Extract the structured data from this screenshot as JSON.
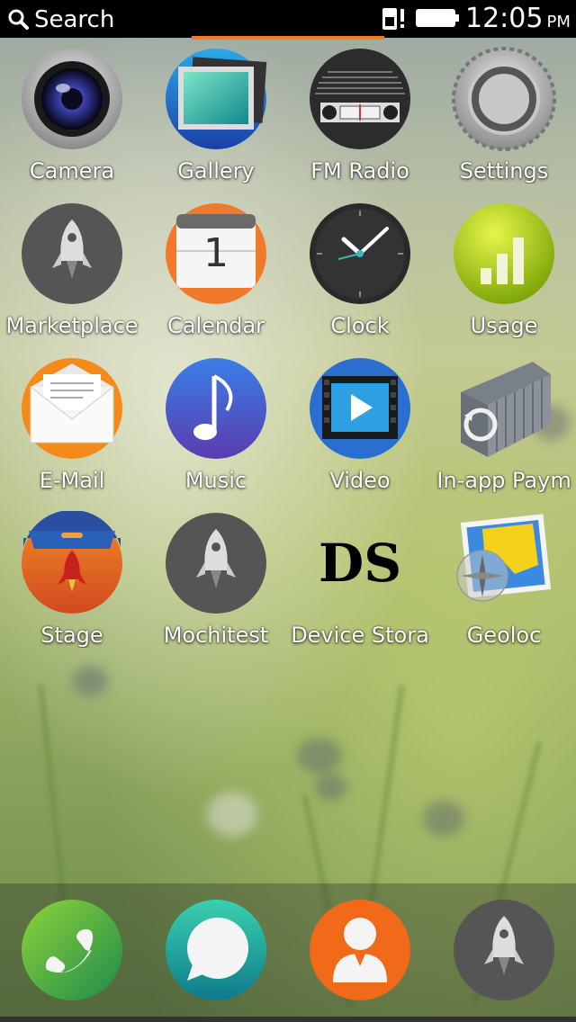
{
  "status_bar": {
    "search_label": "Search",
    "time": "12:05",
    "ampm": "PM"
  },
  "apps": [
    {
      "label": "Camera",
      "icon": "camera-icon"
    },
    {
      "label": "Gallery",
      "icon": "gallery-icon"
    },
    {
      "label": "FM Radio",
      "icon": "radio-icon"
    },
    {
      "label": "Settings",
      "icon": "settings-gear-icon"
    },
    {
      "label": "Marketplace",
      "icon": "rocket-icon"
    },
    {
      "label": "Calendar",
      "icon": "calendar-icon",
      "badge": "1"
    },
    {
      "label": "Clock",
      "icon": "clock-icon"
    },
    {
      "label": "Usage",
      "icon": "usage-bars-icon"
    },
    {
      "label": "E-Mail",
      "icon": "envelope-icon"
    },
    {
      "label": "Music",
      "icon": "music-note-icon"
    },
    {
      "label": "Video",
      "icon": "video-play-icon"
    },
    {
      "label": "In-app Paym",
      "icon": "container-icon"
    },
    {
      "label": "Stage",
      "icon": "stage-rocket-icon"
    },
    {
      "label": "Mochitest",
      "icon": "rocket-icon"
    },
    {
      "label": "Device Stora",
      "icon": "ds-text-icon",
      "icon_text": "DS"
    },
    {
      "label": "Geoloc",
      "icon": "map-compass-icon"
    }
  ],
  "dock": [
    {
      "icon": "phone-icon"
    },
    {
      "icon": "messages-icon"
    },
    {
      "icon": "contacts-icon"
    },
    {
      "icon": "rocket-icon"
    }
  ],
  "colors": {
    "status_bar_bg": "#000000",
    "progress": "#f47c20"
  }
}
